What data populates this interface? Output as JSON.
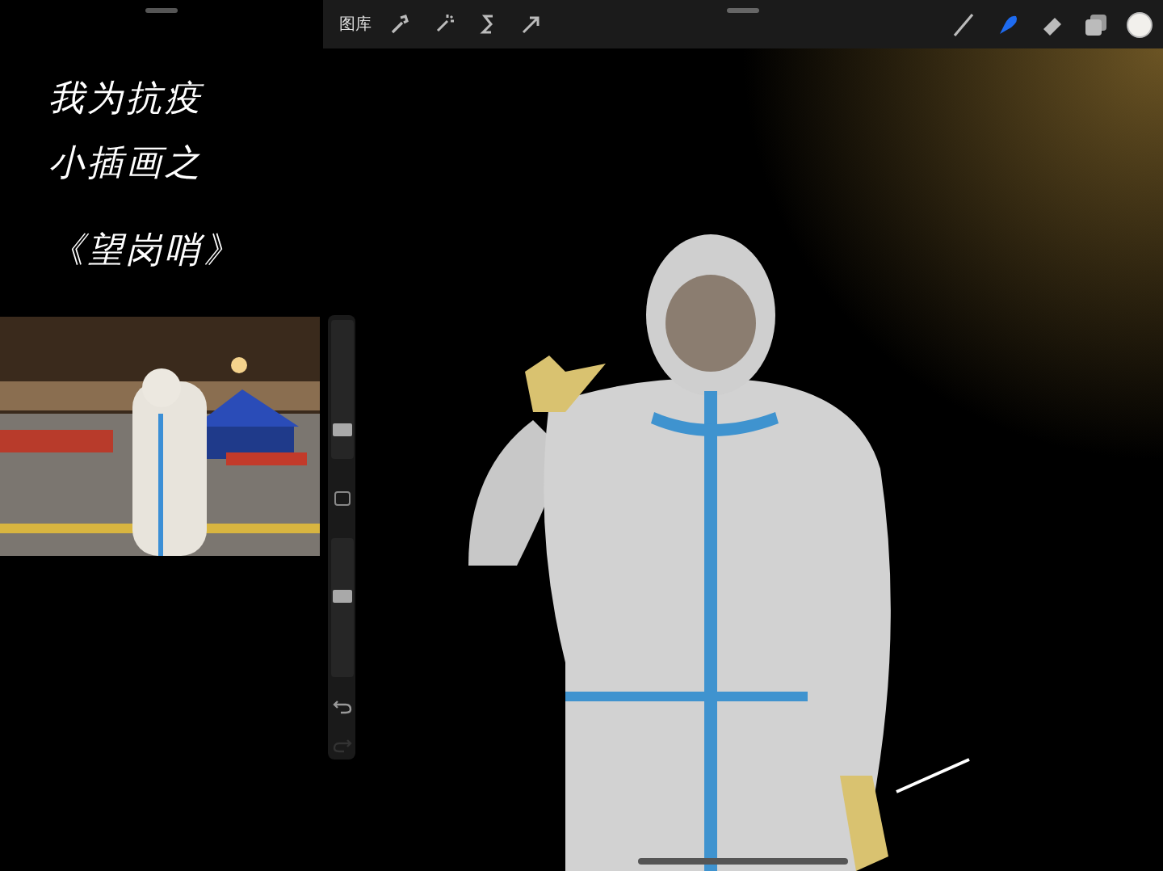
{
  "notes_panel": {
    "lines": [
      "我为抗疫",
      "小插画之",
      "《望岗哨》"
    ]
  },
  "toolbar": {
    "gallery": "图库",
    "tools": [
      {
        "kind": "wrench",
        "selected": false
      },
      {
        "kind": "wand",
        "selected": false
      },
      {
        "kind": "select",
        "selected": false
      },
      {
        "kind": "move",
        "selected": false
      },
      {
        "kind": "brush",
        "selected": false
      },
      {
        "kind": "smudge",
        "selected": true
      },
      {
        "kind": "eraser",
        "selected": false
      },
      {
        "kind": "layers",
        "selected": false
      },
      {
        "kind": "color",
        "selected": false
      }
    ]
  },
  "sidebar": {
    "brush_size": {
      "level": 0.17
    },
    "opacity": {
      "level": 0.58
    },
    "undo": {
      "disabled": false
    },
    "redo": {
      "disabled": true
    }
  }
}
